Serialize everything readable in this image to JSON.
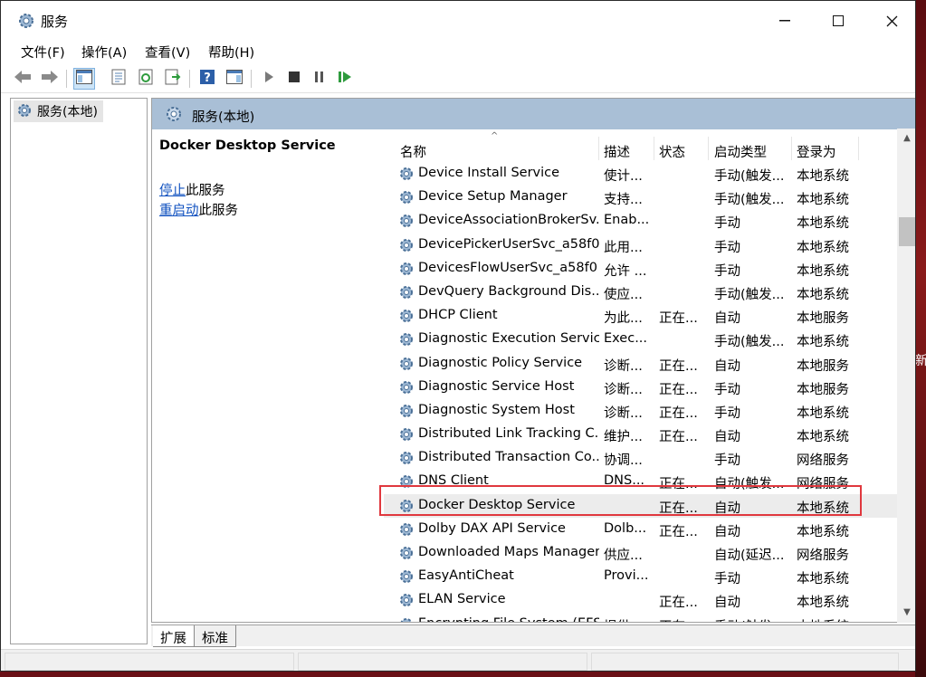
{
  "window": {
    "title": "服务"
  },
  "desktop": {
    "edge_glyph": "新"
  },
  "menu": [
    "文件(F)",
    "操作(A)",
    "查看(V)",
    "帮助(H)"
  ],
  "tree": {
    "item": "服务(本地)"
  },
  "main": {
    "header": "服务(本地)",
    "selected_service": "Docker Desktop Service",
    "actions": [
      {
        "link": "停止",
        "suffix": "此服务"
      },
      {
        "link": "重启动",
        "suffix": "此服务"
      }
    ]
  },
  "columns": [
    "名称",
    "描述",
    "状态",
    "启动类型",
    "登录为"
  ],
  "services": [
    {
      "name": "Device Install Service",
      "desc": "使计...",
      "status": "",
      "startup": "手动(触发...",
      "logon": "本地系统"
    },
    {
      "name": "Device Setup Manager",
      "desc": "支持...",
      "status": "",
      "startup": "手动(触发...",
      "logon": "本地系统"
    },
    {
      "name": "DeviceAssociationBrokerSv...",
      "desc": "Enab...",
      "status": "",
      "startup": "手动",
      "logon": "本地系统"
    },
    {
      "name": "DevicePickerUserSvc_a58f0",
      "desc": "此用...",
      "status": "",
      "startup": "手动",
      "logon": "本地系统"
    },
    {
      "name": "DevicesFlowUserSvc_a58f0",
      "desc": "允许 ...",
      "status": "",
      "startup": "手动",
      "logon": "本地系统"
    },
    {
      "name": "DevQuery Background Dis...",
      "desc": "使应...",
      "status": "",
      "startup": "手动(触发...",
      "logon": "本地系统"
    },
    {
      "name": "DHCP Client",
      "desc": "为此...",
      "status": "正在...",
      "startup": "自动",
      "logon": "本地服务"
    },
    {
      "name": "Diagnostic Execution Service",
      "desc": "Exec...",
      "status": "",
      "startup": "手动(触发...",
      "logon": "本地系统"
    },
    {
      "name": "Diagnostic Policy Service",
      "desc": "诊断...",
      "status": "正在...",
      "startup": "自动",
      "logon": "本地服务"
    },
    {
      "name": "Diagnostic Service Host",
      "desc": "诊断...",
      "status": "正在...",
      "startup": "手动",
      "logon": "本地服务"
    },
    {
      "name": "Diagnostic System Host",
      "desc": "诊断...",
      "status": "正在...",
      "startup": "手动",
      "logon": "本地系统"
    },
    {
      "name": "Distributed Link Tracking C...",
      "desc": "维护...",
      "status": "正在...",
      "startup": "自动",
      "logon": "本地系统"
    },
    {
      "name": "Distributed Transaction Co...",
      "desc": "协调...",
      "status": "",
      "startup": "手动",
      "logon": "网络服务"
    },
    {
      "name": "DNS Client",
      "desc": "DNS...",
      "status": "正在...",
      "startup": "自动(触发...",
      "logon": "网络服务"
    },
    {
      "name": "Docker Desktop Service",
      "desc": "",
      "status": "正在...",
      "startup": "自动",
      "logon": "本地系统",
      "selected": true
    },
    {
      "name": "Dolby DAX API Service",
      "desc": "Dolb...",
      "status": "正在...",
      "startup": "自动",
      "logon": "本地系统"
    },
    {
      "name": "Downloaded Maps Manager",
      "desc": "供应...",
      "status": "",
      "startup": "自动(延迟...",
      "logon": "网络服务"
    },
    {
      "name": "EasyAntiCheat",
      "desc": "Provi...",
      "status": "",
      "startup": "手动",
      "logon": "本地系统"
    },
    {
      "name": "ELAN Service",
      "desc": "",
      "status": "正在...",
      "startup": "自动",
      "logon": "本地系统"
    },
    {
      "name": "Encrypting File System (EFS)",
      "desc": "提供...",
      "status": "正在...",
      "startup": "手动(触发...",
      "logon": "本地系统"
    }
  ],
  "tabs": [
    "扩展",
    "标准"
  ],
  "colors": {
    "highlight": "#e0383e",
    "header_band": "#a9bfd6",
    "link": "#0d4fbf"
  },
  "icons": {
    "title": "services-gear-icon",
    "toolbar": [
      "back-arrow-icon",
      "forward-arrow-icon",
      "console-tree-icon",
      "properties-icon",
      "refresh-icon",
      "export-list-icon",
      "help-icon",
      "action-pane-icon",
      "start-icon",
      "stop-icon",
      "pause-icon",
      "restart-icon"
    ]
  }
}
